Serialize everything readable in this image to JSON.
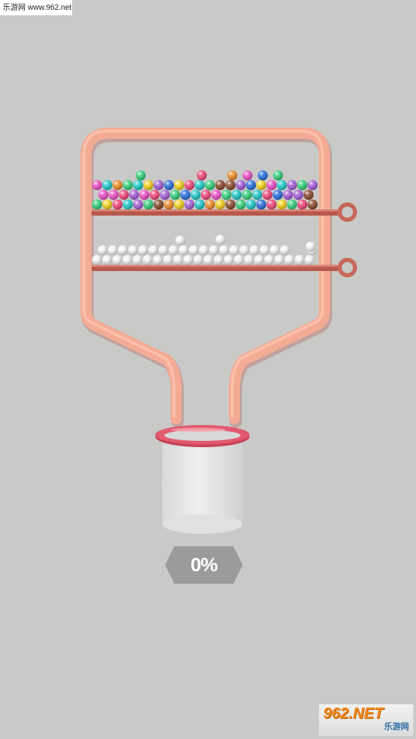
{
  "watermark": {
    "top_text": "乐游网 www.962.net",
    "logo_main": "962.NET",
    "logo_sub": "乐游网"
  },
  "progress": {
    "label": "0%",
    "value": 0
  },
  "colors": {
    "background": "#c9cac8",
    "frame": "#f4ab94",
    "pin": "#c8685a",
    "cup_rim": "#e25a6e",
    "cup_body": "#e4e6e5",
    "progress_pill": "#9a9c99"
  },
  "upper_compartment": {
    "ball_colors": [
      "brown",
      "pink",
      "teal",
      "purple",
      "green",
      "yellow",
      "blue",
      "orange",
      "magenta"
    ],
    "ball_count": 94
  },
  "lower_compartment": {
    "ball_colors": [
      "white"
    ],
    "ball_count": 44
  },
  "pins": [
    {
      "name": "upper-pin",
      "state": "inserted"
    },
    {
      "name": "lower-pin",
      "state": "inserted"
    }
  ]
}
